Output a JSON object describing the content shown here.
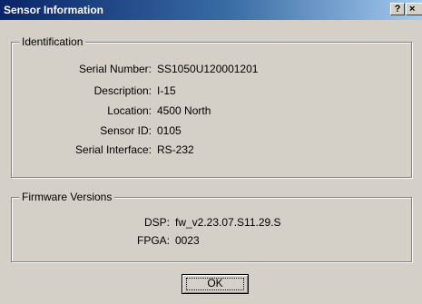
{
  "window": {
    "title": "Sensor Information",
    "help_glyph": "?",
    "close_glyph": "×"
  },
  "identification": {
    "legend": "Identification",
    "rows": [
      {
        "label": "Serial Number:",
        "value": "SS1050U120001201"
      },
      {
        "label": "Description:",
        "value": "I-15"
      },
      {
        "label": "Location:",
        "value": "4500 North"
      },
      {
        "label": "Sensor ID:",
        "value": "0105"
      },
      {
        "label": "Serial Interface:",
        "value": "RS-232"
      }
    ]
  },
  "firmware": {
    "legend": "Firmware Versions",
    "rows": [
      {
        "label": "DSP:",
        "value": "fw_v2.23.07.S11.29.S"
      },
      {
        "label": "FPGA:",
        "value": "0023"
      }
    ]
  },
  "ok_label": "OK"
}
